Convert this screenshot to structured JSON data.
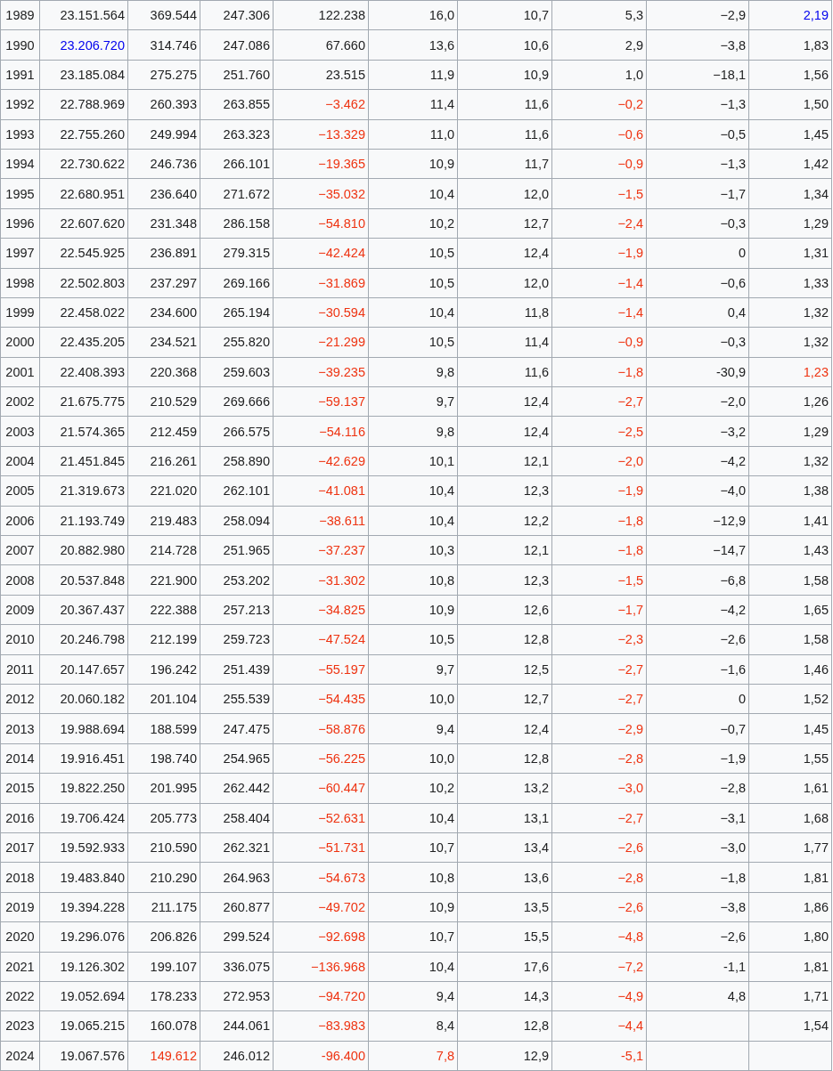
{
  "table": {
    "rows": [
      [
        {
          "text": "1989"
        },
        {
          "text": "23.151.564"
        },
        {
          "text": "369.544"
        },
        {
          "text": "247.306"
        },
        {
          "text": "122.238"
        },
        {
          "text": "16,0"
        },
        {
          "text": "10,7"
        },
        {
          "text": "5,3"
        },
        {
          "text": "−2,9"
        },
        {
          "text": "2,19",
          "color": "#0000ee"
        }
      ],
      [
        {
          "text": "1990"
        },
        {
          "text": "23.206.720",
          "color": "#0000ee"
        },
        {
          "text": "314.746"
        },
        {
          "text": "247.086"
        },
        {
          "text": "67.660"
        },
        {
          "text": "13,6"
        },
        {
          "text": "10,6"
        },
        {
          "text": "2,9"
        },
        {
          "text": "−3,8"
        },
        {
          "text": "1,83"
        }
      ],
      [
        {
          "text": "1991"
        },
        {
          "text": "23.185.084"
        },
        {
          "text": "275.275"
        },
        {
          "text": "251.760"
        },
        {
          "text": "23.515"
        },
        {
          "text": "11,9"
        },
        {
          "text": "10,9"
        },
        {
          "text": "1,0"
        },
        {
          "text": "−18,1"
        },
        {
          "text": "1,56"
        }
      ],
      [
        {
          "text": "1992"
        },
        {
          "text": "22.788.969"
        },
        {
          "text": "260.393"
        },
        {
          "text": "263.855"
        },
        {
          "text": "−3.462",
          "color": "#ee3311"
        },
        {
          "text": "11,4"
        },
        {
          "text": "11,6"
        },
        {
          "text": "−0,2",
          "color": "#ee3311"
        },
        {
          "text": "−1,3"
        },
        {
          "text": "1,50"
        }
      ],
      [
        {
          "text": "1993"
        },
        {
          "text": "22.755.260"
        },
        {
          "text": "249.994"
        },
        {
          "text": "263.323"
        },
        {
          "text": "−13.329",
          "color": "#ee3311"
        },
        {
          "text": "11,0"
        },
        {
          "text": "11,6"
        },
        {
          "text": "−0,6",
          "color": "#ee3311"
        },
        {
          "text": "−0,5"
        },
        {
          "text": "1,45"
        }
      ],
      [
        {
          "text": "1994"
        },
        {
          "text": "22.730.622"
        },
        {
          "text": "246.736"
        },
        {
          "text": "266.101"
        },
        {
          "text": "−19.365",
          "color": "#ee3311"
        },
        {
          "text": "10,9"
        },
        {
          "text": "11,7"
        },
        {
          "text": "−0,9",
          "color": "#ee3311"
        },
        {
          "text": "−1,3"
        },
        {
          "text": "1,42"
        }
      ],
      [
        {
          "text": "1995"
        },
        {
          "text": "22.680.951"
        },
        {
          "text": "236.640"
        },
        {
          "text": "271.672"
        },
        {
          "text": "−35.032",
          "color": "#ee3311"
        },
        {
          "text": "10,4"
        },
        {
          "text": "12,0"
        },
        {
          "text": "−1,5",
          "color": "#ee3311"
        },
        {
          "text": "−1,7"
        },
        {
          "text": "1,34"
        }
      ],
      [
        {
          "text": "1996"
        },
        {
          "text": "22.607.620"
        },
        {
          "text": "231.348"
        },
        {
          "text": "286.158"
        },
        {
          "text": "−54.810",
          "color": "#ee3311"
        },
        {
          "text": "10,2"
        },
        {
          "text": "12,7"
        },
        {
          "text": "−2,4",
          "color": "#ee3311"
        },
        {
          "text": "−0,3"
        },
        {
          "text": "1,29"
        }
      ],
      [
        {
          "text": "1997"
        },
        {
          "text": "22.545.925"
        },
        {
          "text": "236.891"
        },
        {
          "text": "279.315"
        },
        {
          "text": "−42.424",
          "color": "#ee3311"
        },
        {
          "text": "10,5"
        },
        {
          "text": "12,4"
        },
        {
          "text": "−1,9",
          "color": "#ee3311"
        },
        {
          "text": "0"
        },
        {
          "text": "1,31"
        }
      ],
      [
        {
          "text": "1998"
        },
        {
          "text": "22.502.803"
        },
        {
          "text": "237.297"
        },
        {
          "text": "269.166"
        },
        {
          "text": "−31.869",
          "color": "#ee3311"
        },
        {
          "text": "10,5"
        },
        {
          "text": "12,0"
        },
        {
          "text": "−1,4",
          "color": "#ee3311"
        },
        {
          "text": "−0,6"
        },
        {
          "text": "1,33"
        }
      ],
      [
        {
          "text": "1999"
        },
        {
          "text": "22.458.022"
        },
        {
          "text": "234.600"
        },
        {
          "text": "265.194"
        },
        {
          "text": "−30.594",
          "color": "#ee3311"
        },
        {
          "text": "10,4"
        },
        {
          "text": "11,8"
        },
        {
          "text": "−1,4",
          "color": "#ee3311"
        },
        {
          "text": "0,4"
        },
        {
          "text": "1,32"
        }
      ],
      [
        {
          "text": "2000"
        },
        {
          "text": "22.435.205"
        },
        {
          "text": "234.521"
        },
        {
          "text": "255.820"
        },
        {
          "text": "−21.299",
          "color": "#ee3311"
        },
        {
          "text": "10,5"
        },
        {
          "text": "11,4"
        },
        {
          "text": "−0,9",
          "color": "#ee3311"
        },
        {
          "text": "−0,3"
        },
        {
          "text": "1,32"
        }
      ],
      [
        {
          "text": "2001"
        },
        {
          "text": "22.408.393"
        },
        {
          "text": "220.368"
        },
        {
          "text": "259.603"
        },
        {
          "text": "−39.235",
          "color": "#ee3311"
        },
        {
          "text": "9,8"
        },
        {
          "text": "11,6"
        },
        {
          "text": "−1,8",
          "color": "#ee3311"
        },
        {
          "text": "-30,9"
        },
        {
          "text": "1,23",
          "color": "#ee3311"
        }
      ],
      [
        {
          "text": "2002"
        },
        {
          "text": "21.675.775"
        },
        {
          "text": "210.529"
        },
        {
          "text": "269.666"
        },
        {
          "text": "−59.137",
          "color": "#ee3311"
        },
        {
          "text": "9,7"
        },
        {
          "text": "12,4"
        },
        {
          "text": "−2,7",
          "color": "#ee3311"
        },
        {
          "text": "−2,0"
        },
        {
          "text": "1,26"
        }
      ],
      [
        {
          "text": "2003"
        },
        {
          "text": "21.574.365"
        },
        {
          "text": "212.459"
        },
        {
          "text": "266.575"
        },
        {
          "text": "−54.116",
          "color": "#ee3311"
        },
        {
          "text": "9,8"
        },
        {
          "text": "12,4"
        },
        {
          "text": "−2,5",
          "color": "#ee3311"
        },
        {
          "text": "−3,2"
        },
        {
          "text": "1,29"
        }
      ],
      [
        {
          "text": "2004"
        },
        {
          "text": "21.451.845"
        },
        {
          "text": "216.261"
        },
        {
          "text": "258.890"
        },
        {
          "text": "−42.629",
          "color": "#ee3311"
        },
        {
          "text": "10,1"
        },
        {
          "text": "12,1"
        },
        {
          "text": "−2,0",
          "color": "#ee3311"
        },
        {
          "text": "−4,2"
        },
        {
          "text": "1,32"
        }
      ],
      [
        {
          "text": "2005"
        },
        {
          "text": "21.319.673"
        },
        {
          "text": "221.020"
        },
        {
          "text": "262.101"
        },
        {
          "text": "−41.081",
          "color": "#ee3311"
        },
        {
          "text": "10,4"
        },
        {
          "text": "12,3"
        },
        {
          "text": "−1,9",
          "color": "#ee3311"
        },
        {
          "text": "−4,0"
        },
        {
          "text": "1,38"
        }
      ],
      [
        {
          "text": "2006"
        },
        {
          "text": "21.193.749"
        },
        {
          "text": "219.483"
        },
        {
          "text": "258.094"
        },
        {
          "text": "−38.611",
          "color": "#ee3311"
        },
        {
          "text": "10,4"
        },
        {
          "text": "12,2"
        },
        {
          "text": "−1,8",
          "color": "#ee3311"
        },
        {
          "text": "−12,9"
        },
        {
          "text": "1,41"
        }
      ],
      [
        {
          "text": "2007"
        },
        {
          "text": "20.882.980"
        },
        {
          "text": "214.728"
        },
        {
          "text": "251.965"
        },
        {
          "text": "−37.237",
          "color": "#ee3311"
        },
        {
          "text": "10,3"
        },
        {
          "text": "12,1"
        },
        {
          "text": "−1,8",
          "color": "#ee3311"
        },
        {
          "text": "−14,7"
        },
        {
          "text": "1,43"
        }
      ],
      [
        {
          "text": "2008"
        },
        {
          "text": "20.537.848"
        },
        {
          "text": "221.900"
        },
        {
          "text": "253.202"
        },
        {
          "text": "−31.302",
          "color": "#ee3311"
        },
        {
          "text": "10,8"
        },
        {
          "text": "12,3"
        },
        {
          "text": "−1,5",
          "color": "#ee3311"
        },
        {
          "text": "−6,8"
        },
        {
          "text": "1,58"
        }
      ],
      [
        {
          "text": "2009"
        },
        {
          "text": "20.367.437"
        },
        {
          "text": "222.388"
        },
        {
          "text": "257.213"
        },
        {
          "text": "−34.825",
          "color": "#ee3311"
        },
        {
          "text": "10,9"
        },
        {
          "text": "12,6"
        },
        {
          "text": "−1,7",
          "color": "#ee3311"
        },
        {
          "text": "−4,2"
        },
        {
          "text": "1,65"
        }
      ],
      [
        {
          "text": "2010"
        },
        {
          "text": "20.246.798"
        },
        {
          "text": "212.199"
        },
        {
          "text": "259.723"
        },
        {
          "text": "−47.524",
          "color": "#ee3311"
        },
        {
          "text": "10,5"
        },
        {
          "text": "12,8"
        },
        {
          "text": "−2,3",
          "color": "#ee3311"
        },
        {
          "text": "−2,6"
        },
        {
          "text": "1,58"
        }
      ],
      [
        {
          "text": "2011"
        },
        {
          "text": "20.147.657"
        },
        {
          "text": "196.242"
        },
        {
          "text": "251.439"
        },
        {
          "text": "−55.197",
          "color": "#ee3311"
        },
        {
          "text": "9,7"
        },
        {
          "text": "12,5"
        },
        {
          "text": "−2,7",
          "color": "#ee3311"
        },
        {
          "text": "−1,6"
        },
        {
          "text": "1,46"
        }
      ],
      [
        {
          "text": "2012"
        },
        {
          "text": "20.060.182"
        },
        {
          "text": "201.104"
        },
        {
          "text": "255.539"
        },
        {
          "text": "−54.435",
          "color": "#ee3311"
        },
        {
          "text": "10,0"
        },
        {
          "text": "12,7"
        },
        {
          "text": "−2,7",
          "color": "#ee3311"
        },
        {
          "text": "0"
        },
        {
          "text": "1,52"
        }
      ],
      [
        {
          "text": "2013"
        },
        {
          "text": "19.988.694"
        },
        {
          "text": "188.599"
        },
        {
          "text": "247.475"
        },
        {
          "text": "−58.876",
          "color": "#ee3311"
        },
        {
          "text": "9,4"
        },
        {
          "text": "12,4"
        },
        {
          "text": "−2,9",
          "color": "#ee3311"
        },
        {
          "text": "−0,7"
        },
        {
          "text": "1,45"
        }
      ],
      [
        {
          "text": "2014"
        },
        {
          "text": "19.916.451"
        },
        {
          "text": "198.740"
        },
        {
          "text": "254.965"
        },
        {
          "text": "−56.225",
          "color": "#ee3311"
        },
        {
          "text": "10,0"
        },
        {
          "text": "12,8"
        },
        {
          "text": "−2,8",
          "color": "#ee3311"
        },
        {
          "text": "−1,9"
        },
        {
          "text": "1,55"
        }
      ],
      [
        {
          "text": "2015"
        },
        {
          "text": "19.822.250"
        },
        {
          "text": "201.995"
        },
        {
          "text": "262.442"
        },
        {
          "text": "−60.447",
          "color": "#ee3311"
        },
        {
          "text": "10,2"
        },
        {
          "text": "13,2"
        },
        {
          "text": "−3,0",
          "color": "#ee3311"
        },
        {
          "text": "−2,8"
        },
        {
          "text": "1,61"
        }
      ],
      [
        {
          "text": "2016"
        },
        {
          "text": "19.706.424"
        },
        {
          "text": "205.773"
        },
        {
          "text": "258.404"
        },
        {
          "text": "−52.631",
          "color": "#ee3311"
        },
        {
          "text": "10,4"
        },
        {
          "text": "13,1"
        },
        {
          "text": "−2,7",
          "color": "#ee3311"
        },
        {
          "text": "−3,1"
        },
        {
          "text": "1,68"
        }
      ],
      [
        {
          "text": "2017"
        },
        {
          "text": "19.592.933"
        },
        {
          "text": "210.590"
        },
        {
          "text": "262.321"
        },
        {
          "text": "−51.731",
          "color": "#ee3311"
        },
        {
          "text": "10,7"
        },
        {
          "text": "13,4"
        },
        {
          "text": "−2,6",
          "color": "#ee3311"
        },
        {
          "text": "−3,0"
        },
        {
          "text": "1,77"
        }
      ],
      [
        {
          "text": "2018"
        },
        {
          "text": "19.483.840"
        },
        {
          "text": "210.290"
        },
        {
          "text": "264.963"
        },
        {
          "text": "−54.673",
          "color": "#ee3311"
        },
        {
          "text": "10,8"
        },
        {
          "text": "13,6"
        },
        {
          "text": "−2,8",
          "color": "#ee3311"
        },
        {
          "text": "−1,8"
        },
        {
          "text": "1,81"
        }
      ],
      [
        {
          "text": "2019"
        },
        {
          "text": "19.394.228"
        },
        {
          "text": "211.175"
        },
        {
          "text": "260.877"
        },
        {
          "text": "−49.702",
          "color": "#ee3311"
        },
        {
          "text": "10,9"
        },
        {
          "text": "13,5"
        },
        {
          "text": "−2,6",
          "color": "#ee3311"
        },
        {
          "text": "−3,8"
        },
        {
          "text": "1,86"
        }
      ],
      [
        {
          "text": "2020"
        },
        {
          "text": "19.296.076"
        },
        {
          "text": "206.826"
        },
        {
          "text": "299.524"
        },
        {
          "text": "−92.698",
          "color": "#ee3311"
        },
        {
          "text": "10,7"
        },
        {
          "text": "15,5"
        },
        {
          "text": "−4,8",
          "color": "#ee3311"
        },
        {
          "text": "−2,6"
        },
        {
          "text": "1,80"
        }
      ],
      [
        {
          "text": "2021"
        },
        {
          "text": "19.126.302"
        },
        {
          "text": "199.107"
        },
        {
          "text": "336.075"
        },
        {
          "text": "−136.968",
          "color": "#ee3311"
        },
        {
          "text": "10,4"
        },
        {
          "text": "17,6"
        },
        {
          "text": "−7,2",
          "color": "#ee3311"
        },
        {
          "text": "-1,1"
        },
        {
          "text": "1,81"
        }
      ],
      [
        {
          "text": "2022"
        },
        {
          "text": "19.052.694"
        },
        {
          "text": "178.233"
        },
        {
          "text": "272.953"
        },
        {
          "text": "−94.720",
          "color": "#ee3311"
        },
        {
          "text": "9,4"
        },
        {
          "text": "14,3"
        },
        {
          "text": "−4,9",
          "color": "#ee3311"
        },
        {
          "text": "4,8"
        },
        {
          "text": "1,71"
        }
      ],
      [
        {
          "text": "2023"
        },
        {
          "text": "19.065.215"
        },
        {
          "text": "160.078"
        },
        {
          "text": "244.061"
        },
        {
          "text": "−83.983",
          "color": "#ee3311"
        },
        {
          "text": "8,4"
        },
        {
          "text": "12,8"
        },
        {
          "text": "−4,4",
          "color": "#ee3311"
        },
        null,
        {
          "text": "1,54"
        }
      ],
      [
        {
          "text": "2024"
        },
        {
          "text": "19.067.576"
        },
        {
          "text": "149.612",
          "color": "#ee3311"
        },
        {
          "text": "246.012"
        },
        {
          "text": "-96.400",
          "color": "#ee3311"
        },
        {
          "text": "7,8",
          "color": "#ee3311"
        },
        {
          "text": "12,9"
        },
        {
          "text": "-5,1",
          "color": "#ee3311"
        },
        null,
        null
      ]
    ]
  }
}
